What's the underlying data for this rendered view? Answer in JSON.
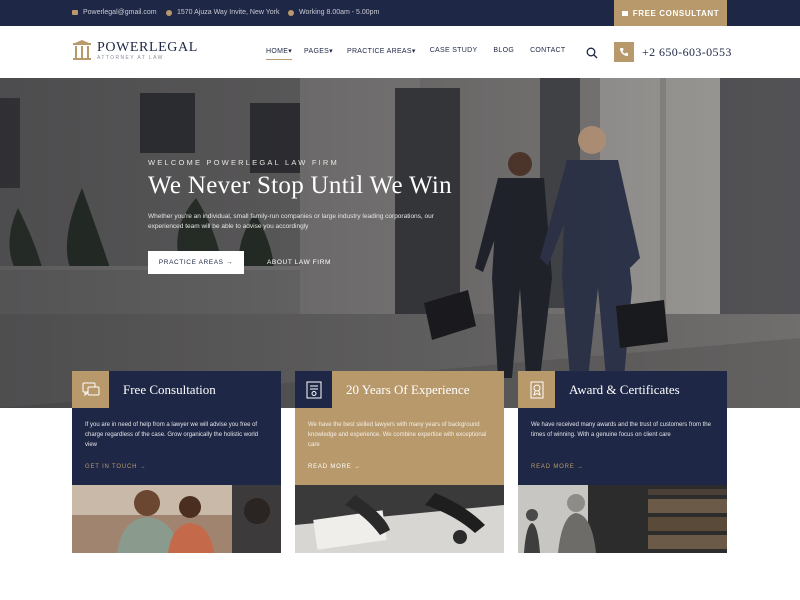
{
  "topbar": {
    "email": "Powerlegal@gmail.com",
    "address": "1570 Ajuza Way Invite, New York",
    "hours": "Working 8.00am - 5.00pm",
    "cta_label": "FREE CONSULTANT"
  },
  "nav": {
    "brand": "POWERLEGAL",
    "tagline": "ATTORNEY AT LAW",
    "menu": [
      "HOME",
      "PAGES",
      "PRACTICE AREAS",
      "CASE STUDY",
      "BLOG",
      "CONTACT"
    ],
    "phone": "+2 650-603-0553"
  },
  "hero": {
    "welcome": "WELCOME POWERLEGAL LAW FIRM",
    "headline": "We Never Stop Until We Win",
    "description": "Whether you're an individual, small family-run companies or large industry leading corporations, our experienced team will be able to advise you accordingly",
    "primary_btn": "PRACTICE AREAS →",
    "link_btn": "ABOUT LAW FIRM"
  },
  "cards": [
    {
      "title": "Free Consultation",
      "description": "If you are in need of help from a lawyer we will advise you free of charge regardless of the case. Grow organically the holistic world view",
      "link": "GET IN TOUCH →"
    },
    {
      "title": "20 Years Of Experience",
      "description": "We have the best skilled lawyers with many years of background knowledge and experience. We combine expertise with exceptional care",
      "link": "READ MORE →"
    },
    {
      "title": "Award & Certificates",
      "description": "We have received many awards and the trust of customers from the times of winning. With a genuine focus on client care",
      "link": "READ MORE →"
    }
  ],
  "colors": {
    "navy": "#1e2745",
    "gold": "#b8996b"
  }
}
